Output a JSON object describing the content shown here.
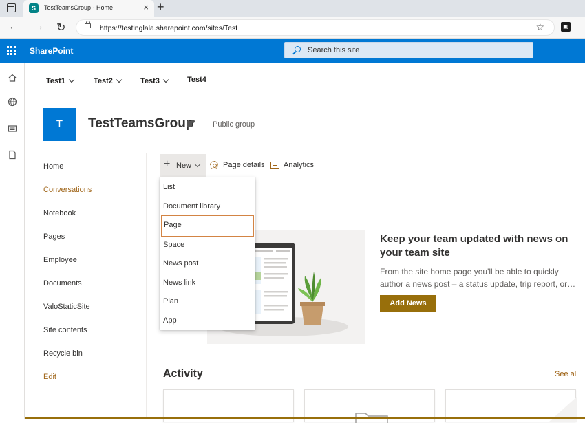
{
  "browser": {
    "tab_title": "TestTeamsGroup - Home",
    "close_glyph": "×",
    "new_tab_glyph": "+",
    "url": "https://testinglala.sharepoint.com/sites/Test",
    "back_glyph": "←",
    "forward_glyph": "→",
    "refresh_glyph": "↻",
    "favorite_glyph": "☆"
  },
  "suite": {
    "brand": "SharePoint",
    "search_placeholder": "Search this site",
    "accent_color": "#0078d4"
  },
  "hub_nav": [
    {
      "label": "Test1",
      "has_chevron": true
    },
    {
      "label": "Test2",
      "has_chevron": true
    },
    {
      "label": "Test3",
      "has_chevron": true
    },
    {
      "label": "Test4",
      "has_chevron": false
    }
  ],
  "site": {
    "logo_letter": "T",
    "name": "TestTeamsGroup",
    "privacy": "Public group"
  },
  "left_nav": [
    {
      "label": "Home",
      "accent": false
    },
    {
      "label": "Conversations",
      "accent": true
    },
    {
      "label": "Notebook",
      "accent": false
    },
    {
      "label": "Pages",
      "accent": false
    },
    {
      "label": "Employee",
      "accent": false
    },
    {
      "label": "Documents",
      "accent": false
    },
    {
      "label": "ValoStaticSite",
      "accent": false
    },
    {
      "label": "Site contents",
      "accent": false
    },
    {
      "label": "Recycle bin",
      "accent": false
    },
    {
      "label": "Edit",
      "accent": true
    }
  ],
  "command_bar": {
    "new_label": "New",
    "page_details_label": "Page details",
    "analytics_label": "Analytics"
  },
  "new_menu": {
    "items": [
      "List",
      "Document library",
      "Page",
      "Space",
      "News post",
      "News link",
      "Plan",
      "App"
    ],
    "selected": "Page"
  },
  "news": {
    "title": "Keep your team updated with news on your team site",
    "description_line1": "From the site home page you'll be able to quickly",
    "description_line2": "author a news post – a status update, trip report, or…",
    "button": "Add News",
    "theme_color": "#986f0b"
  },
  "activity": {
    "heading": "Activity",
    "see_all": "See all"
  },
  "icons": [
    "app-launcher-icon",
    "search-icon",
    "home-icon",
    "globe-icon",
    "news-icon",
    "file-icon",
    "plus-icon",
    "gear-icon",
    "analytics-icon",
    "teams-icon",
    "lock-icon"
  ]
}
